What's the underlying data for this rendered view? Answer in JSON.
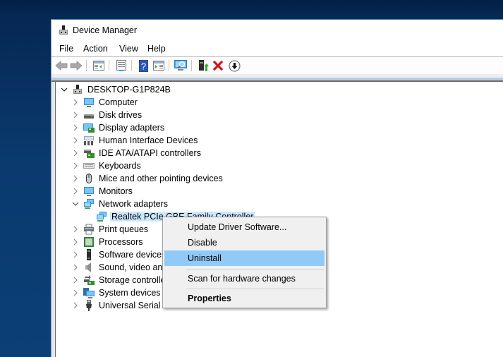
{
  "window": {
    "title": "Device Manager",
    "title_icon": "device-manager-icon"
  },
  "menubar": {
    "items": [
      "File",
      "Action",
      "View",
      "Help"
    ]
  },
  "toolbar": {
    "buttons": [
      {
        "name": "back",
        "icon": "back-arrow-icon",
        "enabled": false
      },
      {
        "name": "forward",
        "icon": "forward-arrow-icon",
        "enabled": false
      },
      {
        "name": "show-hide-console-tree",
        "icon": "console-tree-icon"
      },
      {
        "name": "properties",
        "icon": "properties-icon"
      },
      {
        "name": "help",
        "icon": "help-icon"
      },
      {
        "name": "show-hide-action-pane",
        "icon": "action-pane-icon"
      },
      {
        "name": "scan-hardware",
        "icon": "scan-monitor-icon"
      },
      {
        "name": "update-driver",
        "icon": "update-driver-icon"
      },
      {
        "name": "uninstall",
        "icon": "uninstall-x-icon"
      },
      {
        "name": "disable",
        "icon": "disable-down-arrow-icon"
      }
    ]
  },
  "tree": {
    "root": {
      "label": "DESKTOP-G1P824B",
      "expanded": true
    },
    "categories": [
      {
        "label": "Computer",
        "icon": "computer-icon",
        "expanded": false
      },
      {
        "label": "Disk drives",
        "icon": "disk-drive-icon",
        "expanded": false
      },
      {
        "label": "Display adapters",
        "icon": "display-adapter-icon",
        "expanded": false
      },
      {
        "label": "Human Interface Devices",
        "icon": "hid-icon",
        "expanded": false
      },
      {
        "label": "IDE ATA/ATAPI controllers",
        "icon": "ide-controller-icon",
        "expanded": false
      },
      {
        "label": "Keyboards",
        "icon": "keyboard-icon",
        "expanded": false
      },
      {
        "label": "Mice and other pointing devices",
        "icon": "mouse-icon",
        "expanded": false
      },
      {
        "label": "Monitors",
        "icon": "monitor-icon",
        "expanded": false
      },
      {
        "label": "Network adapters",
        "icon": "network-adapter-icon",
        "expanded": true,
        "children": [
          {
            "label": "Realtek PCIe GBE Family Controller",
            "icon": "network-adapter-icon",
            "selected": true
          }
        ]
      },
      {
        "label": "Print queues",
        "icon": "printer-icon",
        "expanded": false
      },
      {
        "label": "Processors",
        "icon": "processor-icon",
        "expanded": false
      },
      {
        "label": "Software devices",
        "icon": "software-device-icon",
        "expanded": false
      },
      {
        "label": "Sound, video and game controllers",
        "icon": "speaker-icon",
        "expanded": false
      },
      {
        "label": "Storage controllers",
        "icon": "storage-controller-icon",
        "expanded": false
      },
      {
        "label": "System devices",
        "icon": "system-device-icon",
        "expanded": false
      },
      {
        "label": "Universal Serial Bus controllers",
        "icon": "usb-icon",
        "expanded": false
      }
    ]
  },
  "context_menu": {
    "items": [
      {
        "label": "Update Driver Software...",
        "highlighted": false,
        "bold": false
      },
      {
        "label": "Disable",
        "highlighted": false,
        "bold": false
      },
      {
        "label": "Uninstall",
        "highlighted": true,
        "bold": false
      },
      {
        "label": "Scan for hardware changes",
        "highlighted": false,
        "bold": false
      },
      {
        "label": "Properties",
        "highlighted": false,
        "bold": true
      }
    ]
  },
  "colors": {
    "selection": "#cce8ff",
    "menu_highlight": "#91c9f7",
    "menu_bg": "#f0f0f0",
    "desktop": "#0a3a6e"
  }
}
